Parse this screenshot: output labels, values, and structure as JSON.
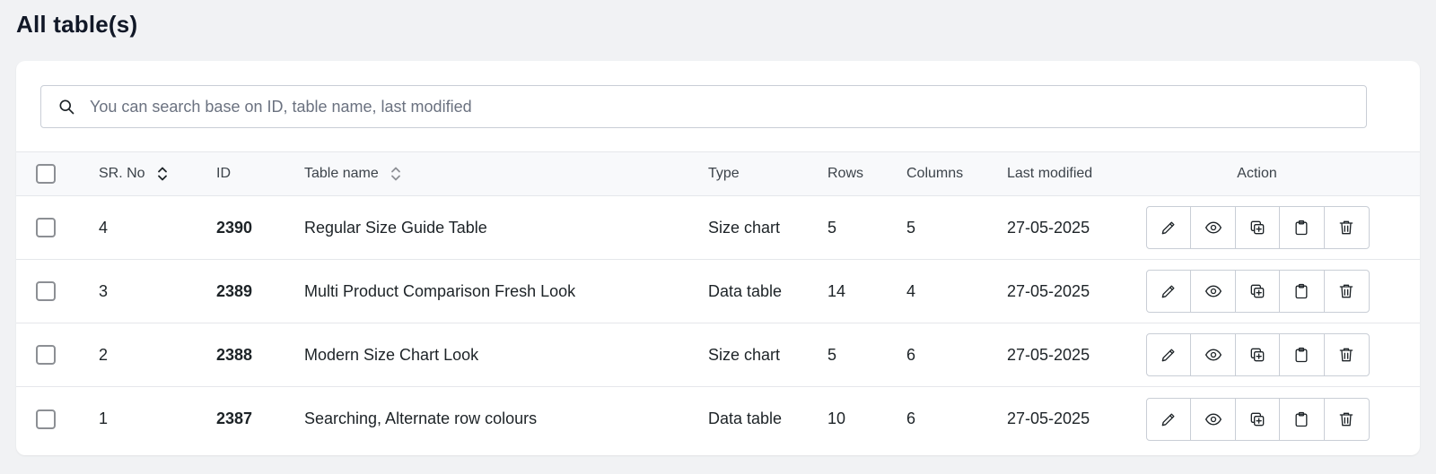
{
  "page": {
    "title": "All table(s)"
  },
  "search": {
    "placeholder": "You can search base on ID, table name, last modified",
    "value": ""
  },
  "table": {
    "headers": {
      "sr_no": "SR. No",
      "id": "ID",
      "table_name": "Table name",
      "type": "Type",
      "rows": "Rows",
      "columns": "Columns",
      "last_modified": "Last modified",
      "action": "Action"
    },
    "rows": [
      {
        "sr_no": "4",
        "id": "2390",
        "name": "Regular Size Guide Table",
        "type": "Size chart",
        "rows": "5",
        "columns": "5",
        "last_modified": "27-05-2025"
      },
      {
        "sr_no": "3",
        "id": "2389",
        "name": "Multi Product Comparison Fresh Look",
        "type": "Data table",
        "rows": "14",
        "columns": "4",
        "last_modified": "27-05-2025"
      },
      {
        "sr_no": "2",
        "id": "2388",
        "name": "Modern Size Chart Look",
        "type": "Size chart",
        "rows": "5",
        "columns": "6",
        "last_modified": "27-05-2025"
      },
      {
        "sr_no": "1",
        "id": "2387",
        "name": "Searching, Alternate row colours",
        "type": "Data table",
        "rows": "10",
        "columns": "6",
        "last_modified": "27-05-2025"
      }
    ],
    "action_icons": [
      "pencil-icon",
      "eye-icon",
      "duplicate-icon",
      "clipboard-icon",
      "trash-icon"
    ]
  },
  "colors": {
    "background": "#f1f2f4",
    "card": "#ffffff",
    "border": "#c9ced6",
    "text": "#1d2327"
  }
}
